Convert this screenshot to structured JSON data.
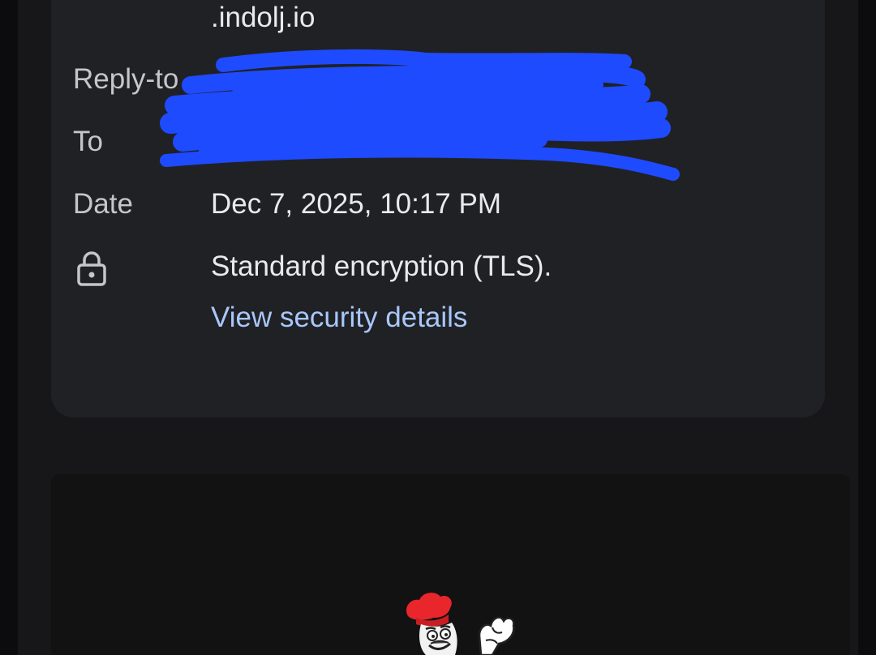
{
  "header": {
    "from_domain": ".indolj.io"
  },
  "details": {
    "reply_to_label": "Reply-to",
    "to_label": "To",
    "date_label": "Date",
    "date_value": "Dec 7, 2025, 10:17 PM",
    "encryption_text": "Standard encryption (TLS).",
    "security_link": "View security details"
  },
  "icons": {
    "lock": "lock-icon",
    "mascot": "chef-mascot-logo"
  },
  "colors": {
    "link": "#a8c7fa",
    "redaction": "#1f4bff",
    "card_bg": "#202125"
  }
}
